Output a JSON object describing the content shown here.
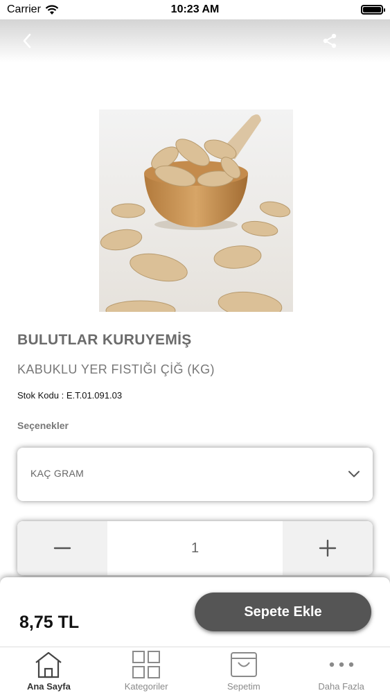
{
  "status_bar": {
    "carrier": "Carrier",
    "time": "10:23 AM"
  },
  "nav": {
    "back_icon": "chevron-left-icon",
    "share_icon": "share-icon"
  },
  "product": {
    "brand": "BULUTLAR KURUYEMİŞ",
    "name": "KABUKLU YER FISTIĞI ÇİĞ (KG)",
    "sku": "Stok Kodu : E.T.01.091.03",
    "options_label": "Seçenekler",
    "option_value": "KAÇ GRAM",
    "quantity": "1",
    "price": "8,75 TL",
    "add_to_cart": "Sepete Ekle"
  },
  "tabs": [
    {
      "label": "Ana Sayfa",
      "icon": "home-icon",
      "active": true
    },
    {
      "label": "Kategoriler",
      "icon": "grid-icon",
      "active": false
    },
    {
      "label": "Sepetim",
      "icon": "cart-icon",
      "active": false
    },
    {
      "label": "Daha Fazla",
      "icon": "more-icon",
      "active": false
    }
  ],
  "colors": {
    "button": "#555555",
    "brand_text": "#6b6b6b",
    "tab_active": "#333333",
    "tab_inactive": "#8a8a8a"
  }
}
